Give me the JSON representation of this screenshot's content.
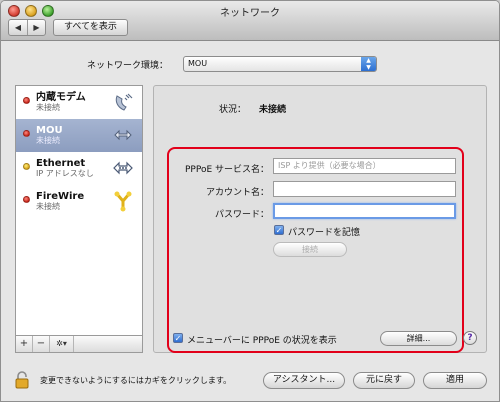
{
  "window": {
    "title": "ネットワーク"
  },
  "toolbar": {
    "back_label": "◀",
    "forward_label": "▶",
    "show_all_label": "すべてを表示"
  },
  "location": {
    "label": "ネットワーク環境：",
    "value": "MOU"
  },
  "services": [
    {
      "name": "内蔵モデム",
      "status": "未接続",
      "dot_color": "#d0261b",
      "icon": "modem-icon",
      "selected": false
    },
    {
      "name": "MOU",
      "status": "未接続",
      "dot_color": "#d0261b",
      "icon": "vpn-icon",
      "selected": true
    },
    {
      "name": "Ethernet",
      "status": "IP アドレスなし",
      "dot_color": "#e1a81c",
      "icon": "ethernet-icon",
      "selected": false
    },
    {
      "name": "FireWire",
      "status": "未接続",
      "dot_color": "#d0261b",
      "icon": "firewire-icon",
      "selected": false
    }
  ],
  "sidebar_footer": {
    "add": "+",
    "remove": "−",
    "action": "✲▾"
  },
  "status": {
    "label": "状況：",
    "value": "未接続"
  },
  "pppoe": {
    "service_name_label": "PPPoE サービス名：",
    "service_name_placeholder": "ISP より提供（必要な場合）",
    "account_label": "アカウント名：",
    "account_value": "",
    "password_label": "パスワード：",
    "password_value": "",
    "remember_password_label": "パスワードを記憶",
    "remember_password_checked": true,
    "connect_label": "接続",
    "show_status_label": "メニューバーに PPPoE の状況を表示",
    "show_status_checked": true,
    "advanced_label": "詳細..."
  },
  "help_label": "?",
  "footer": {
    "lock_text": "変更できないようにするにはカギをクリックします。",
    "assistant_label": "アシスタント...",
    "revert_label": "元に戻す",
    "apply_label": "適用"
  },
  "colors": {
    "highlight_frame": "#e2001a",
    "selection": "#8c9dbf"
  }
}
